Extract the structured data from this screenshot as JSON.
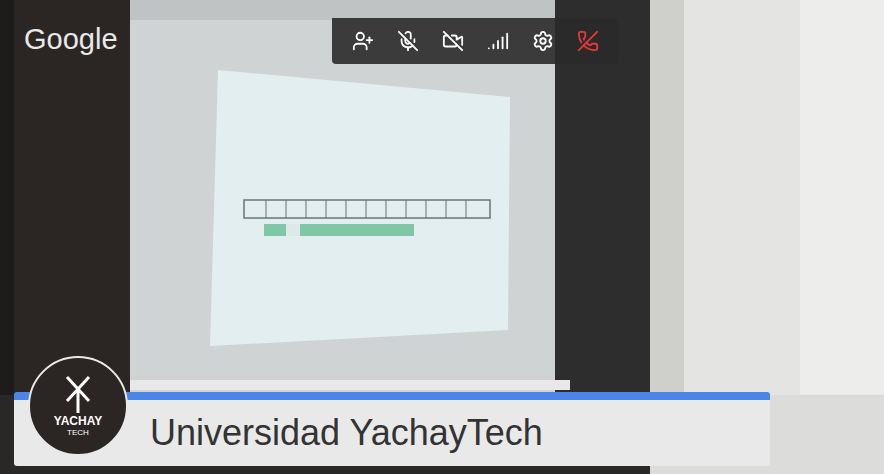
{
  "overlay": {
    "brand": "Google"
  },
  "toolbar": {
    "mic_muted": true,
    "camera_off": true
  },
  "banner": {
    "title": "Universidad YachayTech",
    "logo_lines": [
      "YACHAY",
      "TECH"
    ]
  }
}
